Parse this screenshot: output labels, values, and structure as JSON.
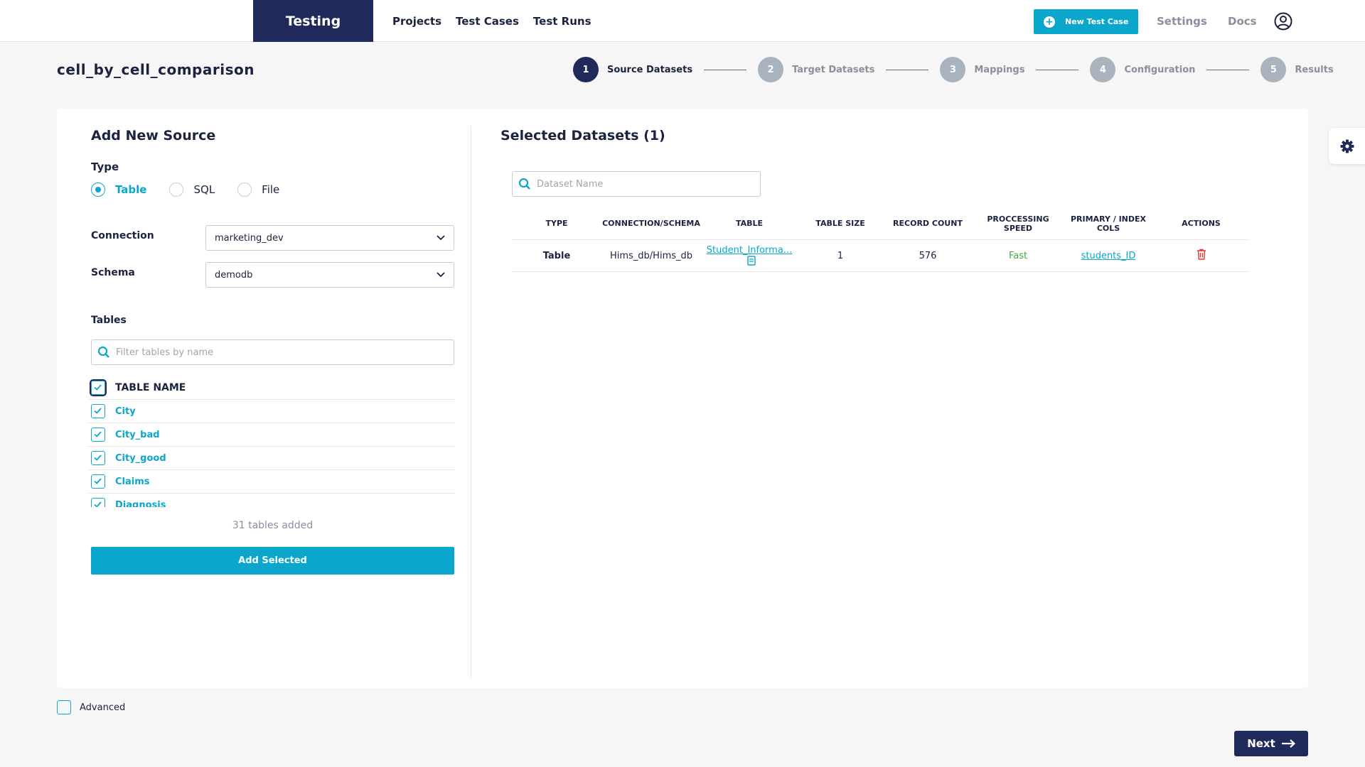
{
  "brand": "Testing",
  "nav": {
    "projects": "Projects",
    "test_cases": "Test Cases",
    "test_runs": "Test Runs"
  },
  "header": {
    "new_test_case": "New Test Case",
    "settings": "Settings",
    "docs": "Docs"
  },
  "page_title": "cell_by_cell_comparison",
  "steps": [
    {
      "num": "1",
      "label": "Source Datasets",
      "active": true
    },
    {
      "num": "2",
      "label": "Target Datasets",
      "active": false
    },
    {
      "num": "3",
      "label": "Mappings",
      "active": false
    },
    {
      "num": "4",
      "label": "Configuration",
      "active": false
    },
    {
      "num": "5",
      "label": "Results",
      "active": false
    }
  ],
  "source": {
    "title": "Add New Source",
    "type_label": "Type",
    "types": [
      "Table",
      "SQL",
      "File"
    ],
    "selected_type": "Table",
    "connection_label": "Connection",
    "connection_value": "marketing_dev",
    "schema_label": "Schema",
    "schema_value": "demodb",
    "tables_label": "Tables",
    "filter_placeholder": "Filter tables by name",
    "table_header": "TABLE NAME",
    "tables": [
      "City",
      "City_bad",
      "City_good",
      "Claims",
      "Diagnosis"
    ],
    "added_text": "31 tables added",
    "add_selected": "Add Selected"
  },
  "selected": {
    "title": "Selected Datasets (1)",
    "search_placeholder": "Dataset Name",
    "columns": [
      "TYPE",
      "CONNECTION/SCHEMA",
      "TABLE",
      "TABLE SIZE",
      "RECORD COUNT",
      "PROCCESSING SPEED",
      "PRIMARY / INDEX COLS",
      "ACTIONS"
    ],
    "rows": [
      {
        "type": "Table",
        "connection": "Hims_db/Hims_db",
        "table": "Student_Informa...",
        "size": "1",
        "records": "576",
        "speed": "Fast",
        "primary": "students_ID"
      }
    ]
  },
  "footer": {
    "advanced": "Advanced",
    "next": "Next"
  },
  "colors": {
    "accent": "#0aa6cb",
    "navy": "#1f2a5a",
    "fast": "#43a843",
    "delete": "#e53935"
  }
}
